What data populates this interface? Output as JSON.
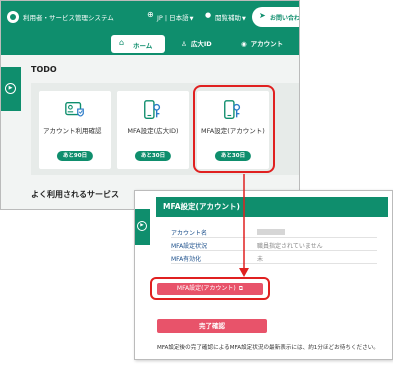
{
  "header": {
    "system_title": "利用者・サービス管理システム",
    "language": "JP | 日本語",
    "user_name": "閲覧補助",
    "contact_button": "お問い合わせ",
    "icons": {
      "logo": "logo-mark",
      "language": "globe-icon",
      "user": "user-icon",
      "contact": "send-icon"
    }
  },
  "nav": {
    "home": "ホーム",
    "wide_id": "広大ID",
    "account": "アカウント",
    "icons": {
      "home": "home-icon",
      "wide_id": "person-icon",
      "account": "account-circle-icon"
    }
  },
  "todo": {
    "title": "TODO",
    "cards": [
      {
        "label": "アカウント利用確認",
        "badge": "あと90日",
        "icon": "id-card-shield-icon"
      },
      {
        "label": "MFA設定(広大ID)",
        "badge": "あと30日",
        "icon": "phone-key-icon"
      },
      {
        "label": "MFA設定(アカウント)",
        "badge": "あと30日",
        "icon": "phone-key-icon"
      }
    ]
  },
  "frequent_services": {
    "title": "よく利用されるサービス"
  },
  "mfa_panel": {
    "title": "MFA設定(アカウント)",
    "rows": [
      {
        "key": "アカウント名",
        "value": ""
      },
      {
        "key": "MFA設定状況",
        "value": "職員指定されていません"
      },
      {
        "key": "MFA有効化",
        "value": "未"
      }
    ],
    "setting_button": "MFA設定(アカウント)",
    "complete_button": "完了確認",
    "note": "MFA設定後の完了確認によるMFA設定状況の最新表示には、約1分ほどお待ちください。"
  },
  "colors": {
    "brand_green": "#0f8e6d",
    "button_pink": "#e8536a",
    "highlight_red": "#e02020"
  }
}
